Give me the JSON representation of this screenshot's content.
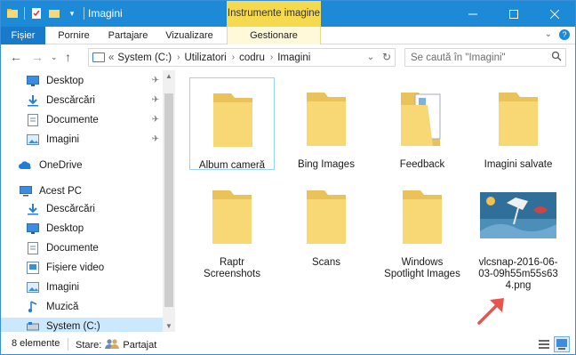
{
  "window": {
    "title": "Imagini",
    "contextual_tab_group": "Instrumente imagine"
  },
  "ribbon": {
    "tabs": [
      {
        "label": "Fișier"
      },
      {
        "label": "Pornire"
      },
      {
        "label": "Partajare"
      },
      {
        "label": "Vizualizare"
      },
      {
        "label": "Gestionare"
      }
    ]
  },
  "address": {
    "overflow": "«",
    "crumbs": [
      "System (C:)",
      "Utilizatori",
      "codru",
      "Imagini"
    ]
  },
  "search": {
    "placeholder": "Se caută în \"Imagini\""
  },
  "nav": {
    "quick_access": [
      {
        "label": "Desktop",
        "icon": "desktop-icon",
        "pinned": true
      },
      {
        "label": "Descărcări",
        "icon": "download-icon",
        "pinned": true
      },
      {
        "label": "Documente",
        "icon": "documents-icon",
        "pinned": true
      },
      {
        "label": "Imagini",
        "icon": "pictures-icon",
        "pinned": true
      }
    ],
    "onedrive": {
      "label": "OneDrive"
    },
    "this_pc": {
      "label": "Acest PC"
    },
    "pc_items": [
      {
        "label": "Descărcări",
        "icon": "download-icon"
      },
      {
        "label": "Desktop",
        "icon": "desktop-icon"
      },
      {
        "label": "Documente",
        "icon": "documents-icon"
      },
      {
        "label": "Fișiere video",
        "icon": "video-icon"
      },
      {
        "label": "Imagini",
        "icon": "pictures-icon"
      },
      {
        "label": "Muzică",
        "icon": "music-icon"
      },
      {
        "label": "System (C:)",
        "icon": "drive-icon",
        "selected": true
      }
    ]
  },
  "files": [
    {
      "name": "Album cameră",
      "type": "folder"
    },
    {
      "name": "Bing Images",
      "type": "folder"
    },
    {
      "name": "Feedback",
      "type": "folder-with-content"
    },
    {
      "name": "Imagini salvate",
      "type": "folder"
    },
    {
      "name": "Raptr Screenshots",
      "type": "folder"
    },
    {
      "name": "Scans",
      "type": "folder"
    },
    {
      "name": "Windows Spotlight Images",
      "type": "folder"
    },
    {
      "name": "vlcsnap-2016-06-03-09h55m55s634.png",
      "type": "image"
    }
  ],
  "status": {
    "count": "8 elemente",
    "state_label": "Stare:",
    "state_value": "Partajat"
  },
  "colors": {
    "titlebar": "#1c8ad6",
    "contextual": "#f5d94f",
    "folder": "#f8d775",
    "arrow": "#e8554e"
  }
}
